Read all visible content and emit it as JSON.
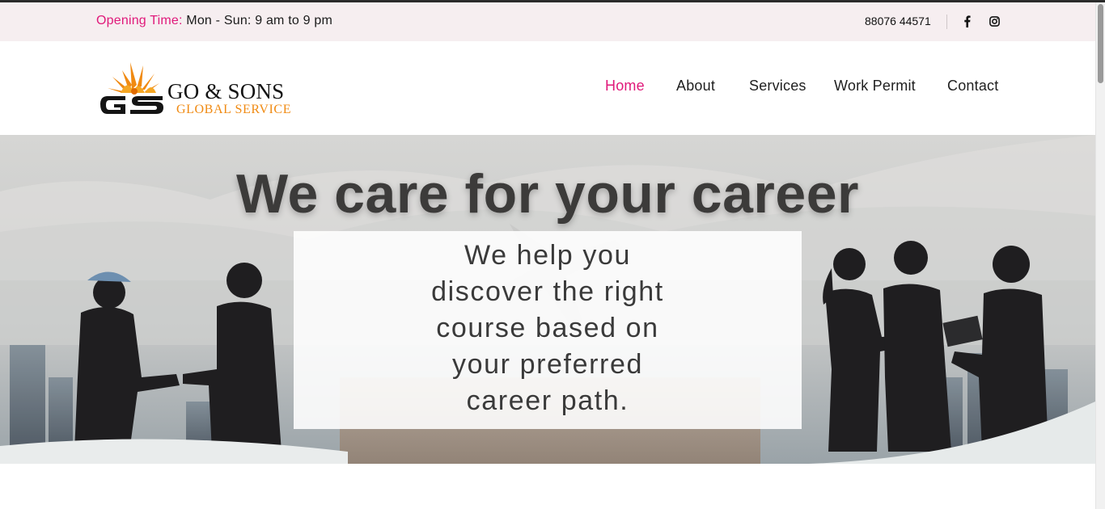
{
  "topbar": {
    "opening_label": "Opening Time:",
    "opening_value": " Mon - Sun: 9 am to 9 pm",
    "phone": "88076 44571",
    "social": [
      {
        "icon": "facebook-icon",
        "glyph": "f"
      },
      {
        "icon": "instagram-icon"
      }
    ]
  },
  "logo": {
    "monogram": "GS",
    "name": "GO & SONS",
    "tagline": "GLOBAL SERVICE"
  },
  "nav": {
    "items": [
      {
        "label": "Home",
        "active": true
      },
      {
        "label": "About",
        "active": false
      },
      {
        "label": "Services",
        "active": false
      },
      {
        "label": "Work Permit",
        "active": false
      },
      {
        "label": "Contact",
        "active": false
      }
    ]
  },
  "hero": {
    "title": "We care for your career",
    "lines": [
      "We help you",
      "discover the right",
      "course based on",
      "your preferred",
      "career path."
    ]
  },
  "colors": {
    "accent": "#e0197a",
    "logo_orange": "#f08a12",
    "topbar_bg": "#f6eef0"
  }
}
